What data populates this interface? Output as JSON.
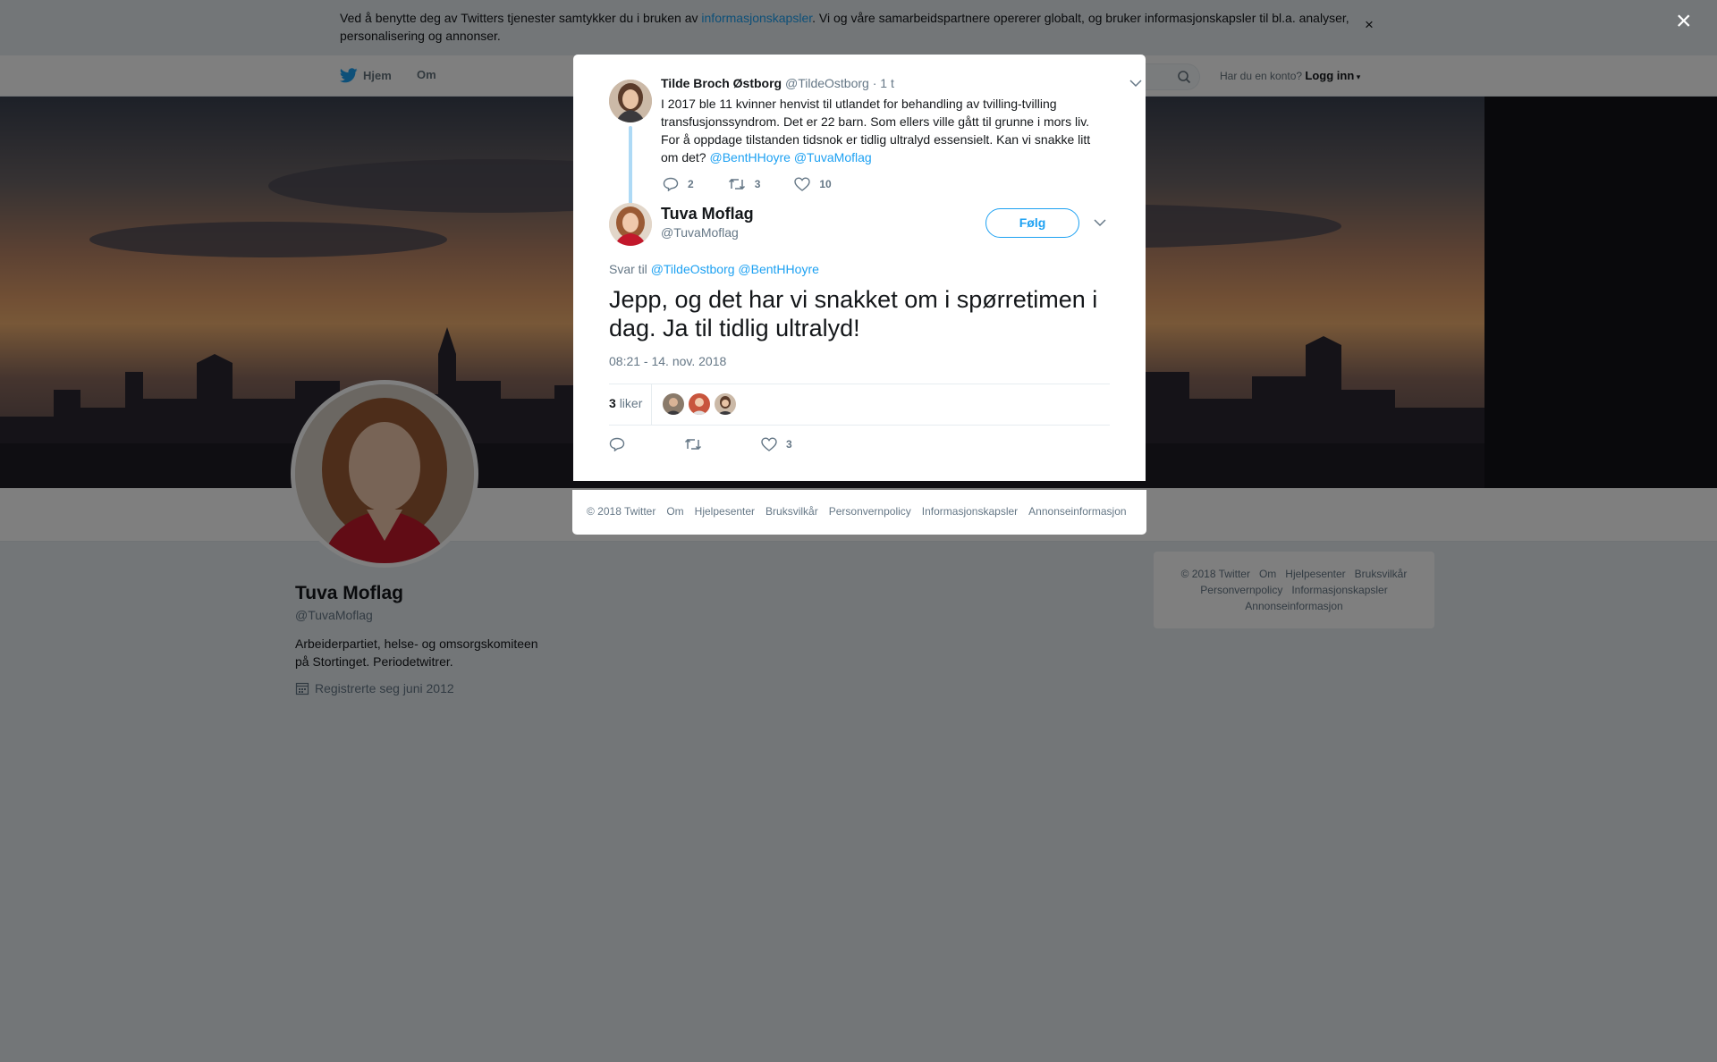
{
  "cookie_banner": {
    "text_before": "Ved å benytte deg av Twitters tjenester samtykker du i bruken av ",
    "link": "informasjonskapsler",
    "text_after": ". Vi og våre samarbeidspartnere opererer globalt, og bruker informasjonskapsler til bl.a. analyser, personalisering og annonser.",
    "close": "×"
  },
  "nav": {
    "home": "Hjem",
    "about": "Om",
    "has_account": "Har du en konto?",
    "login": "Logg inn"
  },
  "profile": {
    "name": "Tuva Moflag",
    "handle": "@TuvaMoflag",
    "bio": "Arbeiderpartiet, helse- og omsorgskomiteen på Stortinget. Periodetwitrer.",
    "joined": "Registrerte seg juni 2012"
  },
  "side_footer": {
    "items": [
      "© 2018 Twitter",
      "Om",
      "Hjelpesenter",
      "Bruksvilkår",
      "Personvernpolicy",
      "Informasjonskapsler",
      "Annonseinformasjon"
    ]
  },
  "overlay": {
    "close": "×"
  },
  "parent_tweet": {
    "name": "Tilde Broch Østborg",
    "handle": "@TildeOstborg",
    "time": "· 1 t",
    "text": "I 2017 ble 11 kvinner henvist til utlandet for behandling av tvilling-tvilling transfusjonssyndrom. Det er 22 barn. Som ellers ville gått til grunne i mors liv. For å oppdage tilstanden tidsnok er tidlig ultralyd essensielt.  Kan vi snakke litt om det?",
    "mention1": "@BentHHoyre",
    "mention2": "@TuvaMoflag",
    "replies": "2",
    "retweets": "3",
    "likes": "10"
  },
  "main_tweet": {
    "name": "Tuva Moflag",
    "handle": "@TuvaMoflag",
    "follow": "Følg",
    "reply_prefix": "Svar til",
    "reply_to1": "@TildeOstborg",
    "reply_to2": "@BentHHoyre",
    "text": "Jepp, og det har vi snakket om i spørretimen i dag. Ja til tidlig ultralyd!",
    "timestamp": "08:21 - 14. nov. 2018",
    "likes_count": "3",
    "likes_label": "liker",
    "likes": "3"
  },
  "modal_footer": {
    "items": [
      "© 2018 Twitter",
      "Om",
      "Hjelpesenter",
      "Bruksvilkår",
      "Personvernpolicy",
      "Informasjonskapsler",
      "Annonseinformasjon"
    ]
  },
  "colors": {
    "accent": "#1da1f2",
    "text": "#14171a",
    "muted": "#657786"
  }
}
